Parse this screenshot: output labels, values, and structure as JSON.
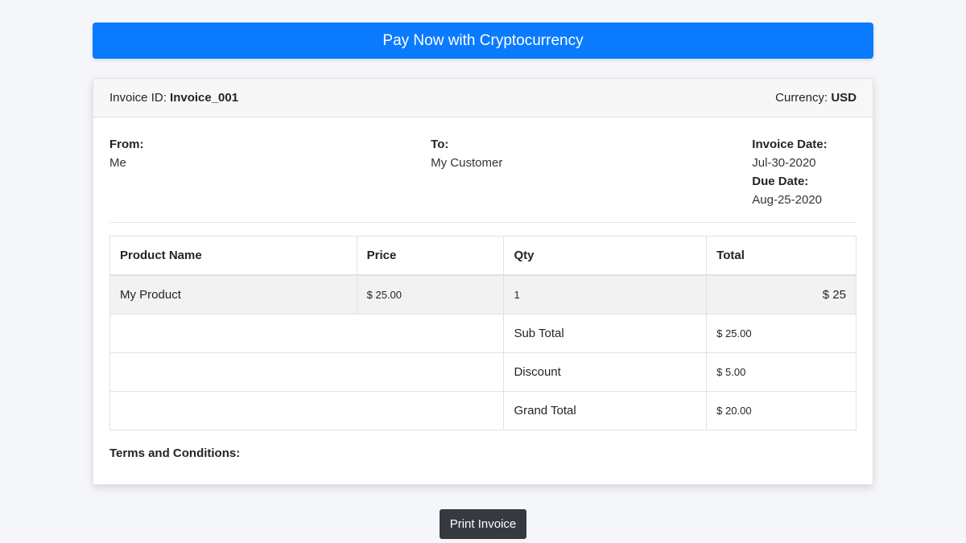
{
  "pay_button": {
    "label": "Pay Now with Cryptocurrency"
  },
  "header": {
    "invoice_id_label": "Invoice ID: ",
    "invoice_id": "Invoice_001",
    "currency_label": "Currency: ",
    "currency": "USD"
  },
  "from": {
    "label": "From:",
    "value": "Me"
  },
  "to": {
    "label": "To:",
    "value": "My Customer"
  },
  "dates": {
    "invoice_date_label": "Invoice Date:",
    "invoice_date": "Jul-30-2020",
    "due_date_label": "Due Date:",
    "due_date": "Aug-25-2020"
  },
  "table": {
    "columns": [
      "Product Name",
      "Price",
      "Qty",
      "Total"
    ],
    "rows": [
      {
        "product": "My Product",
        "price": "$ 25.00",
        "qty": "1",
        "total": "$ 25"
      }
    ],
    "summary": [
      {
        "label": "Sub Total",
        "value": "$ 25.00"
      },
      {
        "label": "Discount",
        "value": "$ 5.00"
      },
      {
        "label": "Grand Total",
        "value": "$ 20.00"
      }
    ]
  },
  "terms": {
    "label": "Terms and Conditions:"
  },
  "print_button": {
    "label": "Print Invoice"
  },
  "colors": {
    "primary": "#0a7bff",
    "dark": "#343a40",
    "background": "#f4f6f9"
  }
}
